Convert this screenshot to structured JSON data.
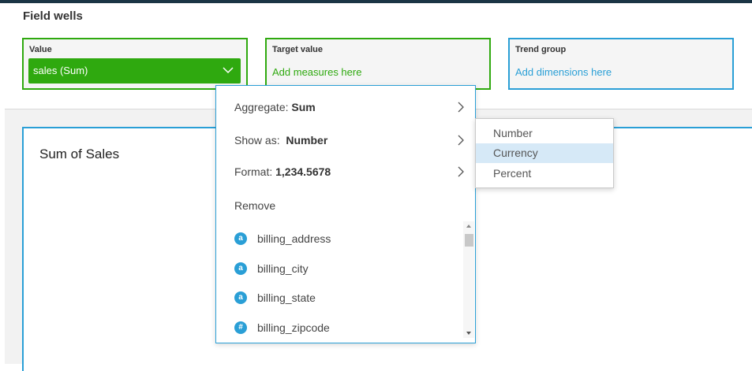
{
  "field_wells": {
    "title": "Field wells",
    "value": {
      "label": "Value",
      "pill": "sales (Sum)"
    },
    "target": {
      "label": "Target value",
      "placeholder": "Add measures here"
    },
    "trend": {
      "label": "Trend group",
      "placeholder": "Add dimensions here"
    }
  },
  "visual": {
    "title": "Sum of Sales"
  },
  "menu": {
    "aggregate_label": "Aggregate:",
    "aggregate_value": "Sum",
    "show_as_label": "Show as:",
    "show_as_value": "Number",
    "format_label": "Format:",
    "format_value": "1,234.5678",
    "remove_label": "Remove",
    "fields": [
      {
        "badge": "a",
        "name": "billing_address"
      },
      {
        "badge": "a",
        "name": "billing_city"
      },
      {
        "badge": "a",
        "name": "billing_state"
      },
      {
        "badge": "#",
        "name": "billing_zipcode"
      }
    ]
  },
  "submenu": {
    "items": [
      "Number",
      "Currency",
      "Percent"
    ],
    "highlighted": "Currency"
  },
  "colors": {
    "green": "#2fa90f",
    "blue": "#2a9fd6",
    "topbar": "#1b3545",
    "highlight": "#d6e9f7"
  }
}
